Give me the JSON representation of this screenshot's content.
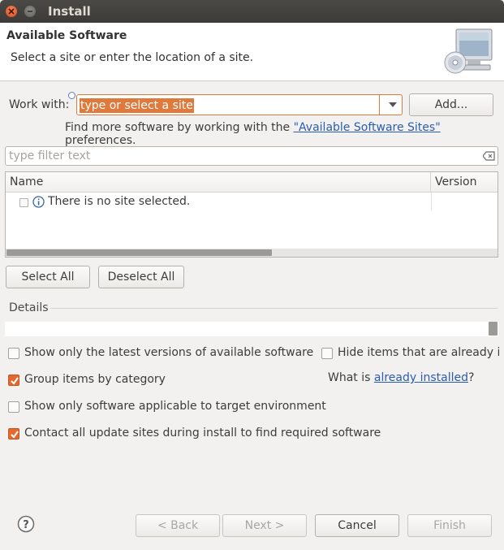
{
  "window": {
    "title": "Install"
  },
  "header": {
    "title": "Available Software",
    "description": "Select a site or enter the location of a site.",
    "image_icon": "computer-cd-icon"
  },
  "workwith": {
    "label": "Work with:",
    "value": "type or select a site",
    "add_label": "Add...",
    "findmore_prefix": "Find more software by working with the ",
    "findmore_link": "\"Available Software Sites\"",
    "findmore_suffix": " preferences."
  },
  "filter": {
    "placeholder": "type filter text"
  },
  "table": {
    "columns": [
      "Name",
      "Version"
    ],
    "rows": [
      {
        "name": "There is no site selected.",
        "version": ""
      }
    ]
  },
  "buttons": {
    "select_all": "Select All",
    "deselect_all": "Deselect All",
    "back": "< Back",
    "next": "Next >",
    "cancel": "Cancel",
    "finish": "Finish"
  },
  "details": {
    "label": "Details"
  },
  "options": {
    "latest_versions": {
      "label": "Show only the latest versions of available software",
      "checked": false
    },
    "hide_installed": {
      "label": "Hide items that are already ins",
      "checked": false
    },
    "group_category": {
      "label": "Group items by category",
      "checked": true
    },
    "target_env": {
      "label": "Show only software applicable to target environment",
      "checked": false
    },
    "contact_sites": {
      "label": "Contact all update sites during install to find required software",
      "checked": true
    },
    "whatis_prefix": "What is ",
    "whatis_link": "already installed",
    "whatis_suffix": "?"
  },
  "colors": {
    "accent": "#e36a2e",
    "link": "#2a5db0",
    "titlebar": "#3c3b37"
  }
}
